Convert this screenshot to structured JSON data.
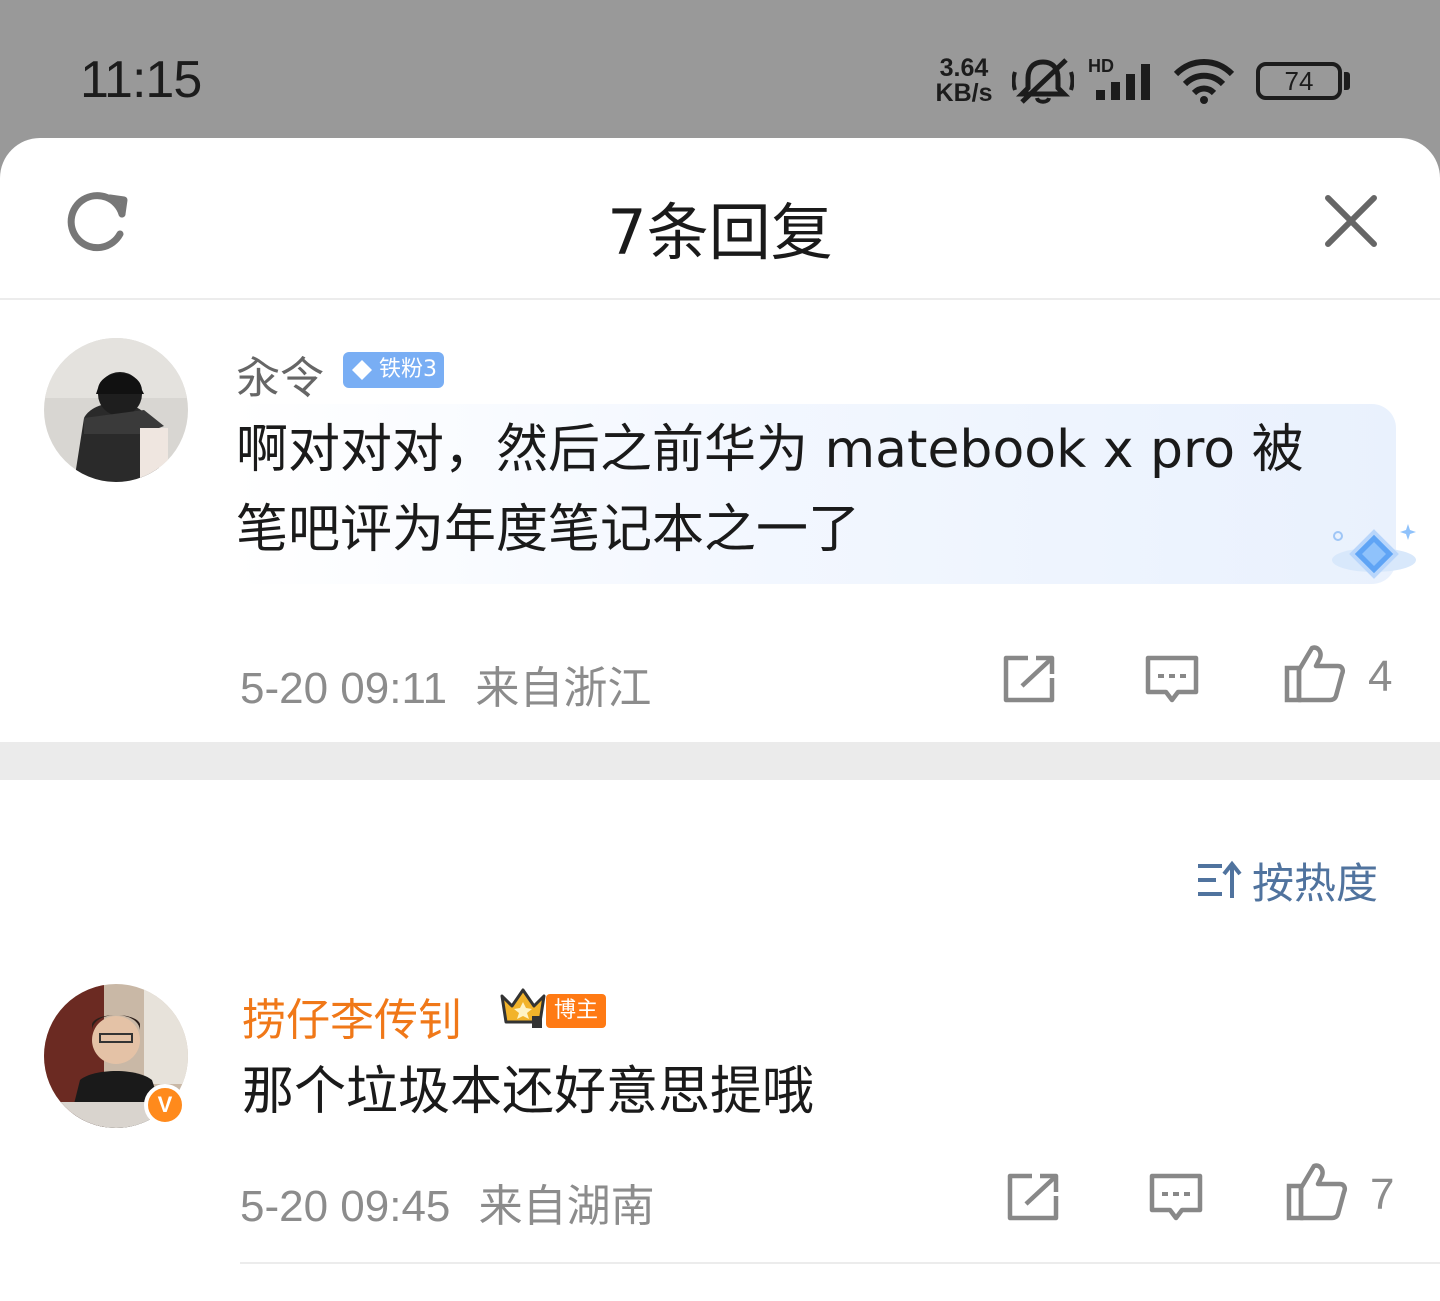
{
  "status_bar": {
    "time": "11:15",
    "net_speed_value": "3.64",
    "net_speed_unit": "KB/s",
    "network_label": "HD",
    "battery": "74",
    "icons": [
      "mute-icon",
      "signal-icon",
      "wifi-icon",
      "battery-icon"
    ]
  },
  "header": {
    "title": "7条回复",
    "icons": [
      "refresh-icon",
      "close-icon"
    ]
  },
  "root_comment": {
    "username": "汆令",
    "fan_badge": "铁粉3",
    "text_line1": "啊对对对，然后之前华为 matebook x pro 被",
    "text_line2": "笔吧评为年度笔记本之一了",
    "time": "5-20 09:11",
    "location": "来自浙江",
    "like_count": "4",
    "icons": [
      "share-icon",
      "comment-icon",
      "like-icon"
    ]
  },
  "sort": {
    "label": "按热度",
    "icon": "sort-icon"
  },
  "replies": [
    {
      "username": "捞仔李传钊",
      "badge": "博主",
      "text": "那个垃圾本还好意思提哦",
      "time": "5-20 09:45",
      "location": "来自湖南",
      "like_count": "7",
      "verify": "V"
    }
  ],
  "colors": {
    "accent_blue": "#50739e",
    "orange_name": "#f07818",
    "badge_blue": "#79aef4",
    "host_badge": "#ff7a14"
  }
}
